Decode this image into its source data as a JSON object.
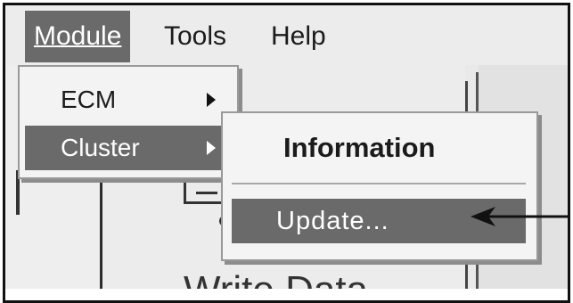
{
  "menubar": {
    "items": [
      {
        "label": "Module"
      },
      {
        "label": "Tools"
      },
      {
        "label": "Help"
      }
    ]
  },
  "module_menu": {
    "items": [
      {
        "label": "ECM"
      },
      {
        "label": "Cluster"
      }
    ]
  },
  "cluster_submenu": {
    "items": [
      {
        "label": "Information"
      },
      {
        "label": "Update..."
      }
    ]
  },
  "background": {
    "caption_partial": "Write Data"
  },
  "colors": {
    "highlight": "#6a6a6a",
    "menu_bg": "#f3f3f3",
    "frame": "#111111"
  }
}
